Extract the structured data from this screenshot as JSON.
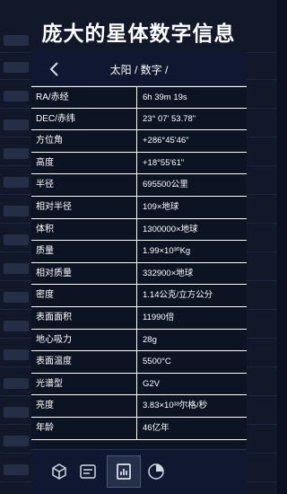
{
  "promo": {
    "title": "庞大的星体数字信息"
  },
  "header": {
    "breadcrumb": "太阳 / 数字 /"
  },
  "rows": [
    {
      "key": "RA/赤经",
      "value": "6h 39m 19s"
    },
    {
      "key": "DEC/赤纬",
      "value": "23° 07' 53.78\""
    },
    {
      "key": "方位角",
      "value": "+286°45'46\""
    },
    {
      "key": "高度",
      "value": "+18°55'61\""
    },
    {
      "key": "半径",
      "value": "695500公里"
    },
    {
      "key": "相对半径",
      "value": "109×地球"
    },
    {
      "key": "体积",
      "value": "1300000×地球"
    },
    {
      "key": "质量",
      "value": "1.99×10³⁰Kg"
    },
    {
      "key": "相对质量",
      "value": "332900×地球"
    },
    {
      "key": "密度",
      "value": "1.14公克/立方公分"
    },
    {
      "key": "表面面积",
      "value": "11990倍"
    },
    {
      "key": "地心吸力",
      "value": "28g"
    },
    {
      "key": "表面温度",
      "value": "5500°C"
    },
    {
      "key": "光谱型",
      "value": "G2V"
    },
    {
      "key": "亮度",
      "value": "3.83×10³³尔格/秒"
    },
    {
      "key": "年龄",
      "value": "46亿年"
    }
  ],
  "tabs": [
    {
      "name": "cube-icon",
      "active": false
    },
    {
      "name": "card-icon",
      "active": false
    },
    {
      "name": "stats-icon",
      "active": true
    },
    {
      "name": "pie-chart-icon",
      "active": false
    }
  ]
}
